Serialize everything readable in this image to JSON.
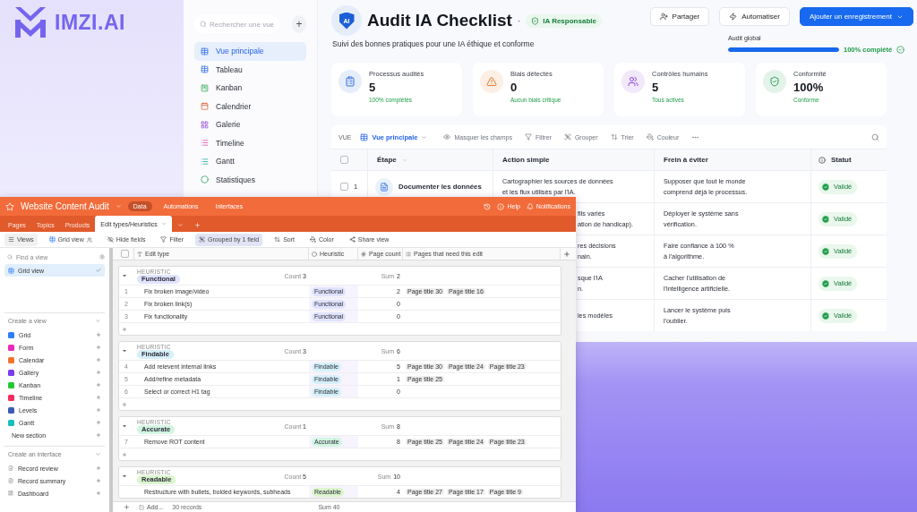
{
  "brand": {
    "name": "IMZI.AI"
  },
  "back_window": {
    "sidebar": {
      "search": {
        "placeholder": "Rechercher une vue"
      },
      "add_button": "+",
      "items": [
        {
          "label": "Vue principale",
          "selected": true,
          "kind": "table"
        },
        {
          "label": "Tableau",
          "selected": false,
          "kind": "table"
        },
        {
          "label": "Kanban",
          "selected": false,
          "kind": "kanban"
        },
        {
          "label": "Calendrier",
          "selected": false,
          "kind": "calendar"
        },
        {
          "label": "Galerie",
          "selected": false,
          "kind": "gallery"
        },
        {
          "label": "Timeline",
          "selected": false,
          "kind": "timeline"
        },
        {
          "label": "Gantt",
          "selected": false,
          "kind": "gantt"
        },
        {
          "label": "Statistiques",
          "selected": false,
          "kind": "stats"
        }
      ]
    },
    "header": {
      "logo_text": "AI",
      "title": "Audit IA Checklist",
      "separator": "·",
      "badge": "IA Responsable",
      "subtitle": "Suivi des bonnes pratiques pour une IA éthique et conforme",
      "buttons": [
        {
          "label": "Partager",
          "kind": "share"
        },
        {
          "label": "Automatiser",
          "kind": "automate"
        },
        {
          "label": "Ajouter un enregistrement",
          "kind": "primary"
        }
      ],
      "progress": {
        "label": "Audit global",
        "level": 1,
        "reading": "100% complété"
      }
    },
    "stats": [
      {
        "label": "Processus audités",
        "value": "5",
        "note": "100% complétés",
        "kind": "clipboard"
      },
      {
        "label": "Biais détectés",
        "value": "0",
        "note": "Aucun biais critique",
        "kind": "warning"
      },
      {
        "label": "Contrôles humains",
        "value": "5",
        "note": "Tous activés",
        "kind": "people"
      },
      {
        "label": "Conformité",
        "value": "100%",
        "note": "Conforme",
        "kind": "shield"
      }
    ],
    "toolbar": {
      "view_label": "VUE",
      "view": "Vue principale",
      "actions": [
        {
          "label": "Masquer les champs",
          "kind": "eye"
        },
        {
          "label": "Filtrer",
          "kind": "filter"
        },
        {
          "label": "Grouper",
          "kind": "group"
        },
        {
          "label": "Trier",
          "kind": "sort"
        },
        {
          "label": "Couleur",
          "kind": "color"
        }
      ]
    },
    "table": {
      "all_checked": false,
      "columns": [
        "Étape",
        "Action simple",
        "Frein à éviter",
        "Statut"
      ],
      "rows": [
        {
          "checked": false,
          "number": "1",
          "step": "Documenter les données",
          "action": "Cartographier les sources de données\net les flux utilisés par l'IA.",
          "clipped": false,
          "obstacle": "Supposer que tout le monde\ncomprend déjà le processus.",
          "status": "Validé"
        },
        {
          "action": "fils variés\nation de handicap).",
          "clipped": true,
          "obstacle": "Déployer le système sans\nvérification.",
          "status": "Validé"
        },
        {
          "action": "res décisions\nnain.",
          "clipped": true,
          "obstacle": "Faire confiance à 100 %\nà l'algorithme.",
          "status": "Validé"
        },
        {
          "action": "sque l'IA\nn.",
          "clipped": true,
          "obstacle": "Cacher l'utilisation de\nl'intelligence artificielle.",
          "status": "Validé"
        },
        {
          "action": "les modèles",
          "clipped": true,
          "obstacle": "Lancer le système puis\nl'oublier.",
          "status": "Validé"
        }
      ]
    }
  },
  "front_window": {
    "title": "Website Content Audit",
    "nav": [
      {
        "label": "Data",
        "selected": true
      },
      {
        "label": "Automations",
        "selected": false
      },
      {
        "label": "Interfaces",
        "selected": false
      }
    ],
    "top_actions": [
      {
        "label": "Help",
        "kind": "help"
      },
      {
        "label": "Notifications",
        "kind": "bell"
      }
    ],
    "tabs": [
      {
        "label": "Pages",
        "selected": false
      },
      {
        "label": "Topics",
        "selected": false
      },
      {
        "label": "Products",
        "selected": false
      },
      {
        "label": "Edit types/Heuristics",
        "selected": true
      }
    ],
    "toolbar": [
      {
        "label": "Views",
        "kind": "views",
        "selected": false
      },
      {
        "label": "Grid view",
        "kind": "grid",
        "selected": false
      },
      {
        "label": "Hide fields",
        "kind": "hide",
        "selected": false
      },
      {
        "label": "Filter",
        "kind": "filter",
        "selected": false
      },
      {
        "label": "Grouped by 1 field",
        "kind": "group",
        "selected": true
      },
      {
        "label": "Sort",
        "kind": "sort",
        "selected": false
      },
      {
        "label": "Color",
        "kind": "color",
        "selected": false
      },
      {
        "label": "Share view",
        "kind": "share",
        "selected": false
      }
    ],
    "sidebar": {
      "search": {
        "placeholder": "Find a view"
      },
      "views": [
        {
          "label": "Grid view",
          "selected": true
        }
      ],
      "create_view": {
        "title": "Create a view",
        "items": [
          {
            "label": "Grid",
            "color": "#2d7ff9"
          },
          {
            "label": "Form",
            "color": "#e929ba"
          },
          {
            "label": "Calendar",
            "color": "#f5732c"
          },
          {
            "label": "Gallery",
            "color": "#7c39ed"
          },
          {
            "label": "Kanban",
            "color": "#20c933"
          },
          {
            "label": "Timeline",
            "color": "#f82b60"
          },
          {
            "label": "Levels",
            "color": "#3b5bb5"
          },
          {
            "label": "Gantt",
            "color": "#18bfbf"
          }
        ],
        "new_section": "New section"
      },
      "create_interface": {
        "title": "Create an interface",
        "items": [
          {
            "label": "Record review",
            "kind": "review"
          },
          {
            "label": "Record summary",
            "kind": "summary"
          },
          {
            "label": "Dashboard",
            "kind": "dashboard"
          }
        ]
      }
    },
    "grid": {
      "all_checked": false,
      "columns": [
        "Edit type",
        "Heuristic",
        "Page count",
        "Pages that need this edit"
      ],
      "groups": [
        {
          "field": "HEURISTIC",
          "name": "Functional",
          "color": "#e0e3fc",
          "count_label": "Count",
          "count": "3",
          "sum_label": "Sum",
          "sum": "2",
          "rows": [
            {
              "number": "1",
              "edit_type": "Fix broken image/video",
              "heuristic": "Functional",
              "page_count": "2",
              "pages": [
                "Page title 30",
                "Page title 16"
              ]
            },
            {
              "number": "2",
              "edit_type": "Fix broken link(s)",
              "heuristic": "Functional",
              "page_count": "0",
              "pages": []
            },
            {
              "number": "3",
              "edit_type": "Fix functionality",
              "heuristic": "Functional",
              "page_count": "0",
              "pages": []
            }
          ]
        },
        {
          "field": "HEURISTIC",
          "name": "Findable",
          "color": "#d5f0f8",
          "count_label": "Count",
          "count": "3",
          "sum_label": "Sum",
          "sum": "6",
          "rows": [
            {
              "number": "4",
              "edit_type": "Add relevent internal links",
              "heuristic": "Findable",
              "page_count": "5",
              "pages": [
                "Page title 30",
                "Page title 24",
                "Page title 23"
              ]
            },
            {
              "number": "5",
              "edit_type": "Add/refine metadata",
              "heuristic": "Findable",
              "page_count": "1",
              "pages": [
                "Page title 25"
              ]
            },
            {
              "number": "6",
              "edit_type": "Select or correct H1 tag",
              "heuristic": "Findable",
              "page_count": "0",
              "pages": []
            }
          ]
        },
        {
          "field": "HEURISTIC",
          "name": "Accurate",
          "color": "#d2f5e2",
          "count_label": "Count",
          "count": "1",
          "sum_label": "Sum",
          "sum": "8",
          "rows": [
            {
              "number": "7",
              "edit_type": "Remove ROT content",
              "heuristic": "Accurate",
              "page_count": "8",
              "pages": [
                "Page title 25",
                "Page title 24",
                "Page title 23"
              ]
            }
          ]
        },
        {
          "field": "HEURISTIC",
          "name": "Readable",
          "color": "#dbf5cd",
          "count_label": "Count",
          "count": "5",
          "sum_label": "Sum",
          "sum": "10",
          "rows": [
            {
              "edit_type": "Restructure with bullets, bolded keywords, subheads",
              "heuristic": "Readable",
              "page_count": "4",
              "pages": [
                "Page title 27",
                "Page title 17",
                "Page title 9"
              ]
            }
          ]
        }
      ],
      "footer": {
        "add": "Add...",
        "records": "30 records",
        "sum": "Sum 40"
      }
    }
  }
}
